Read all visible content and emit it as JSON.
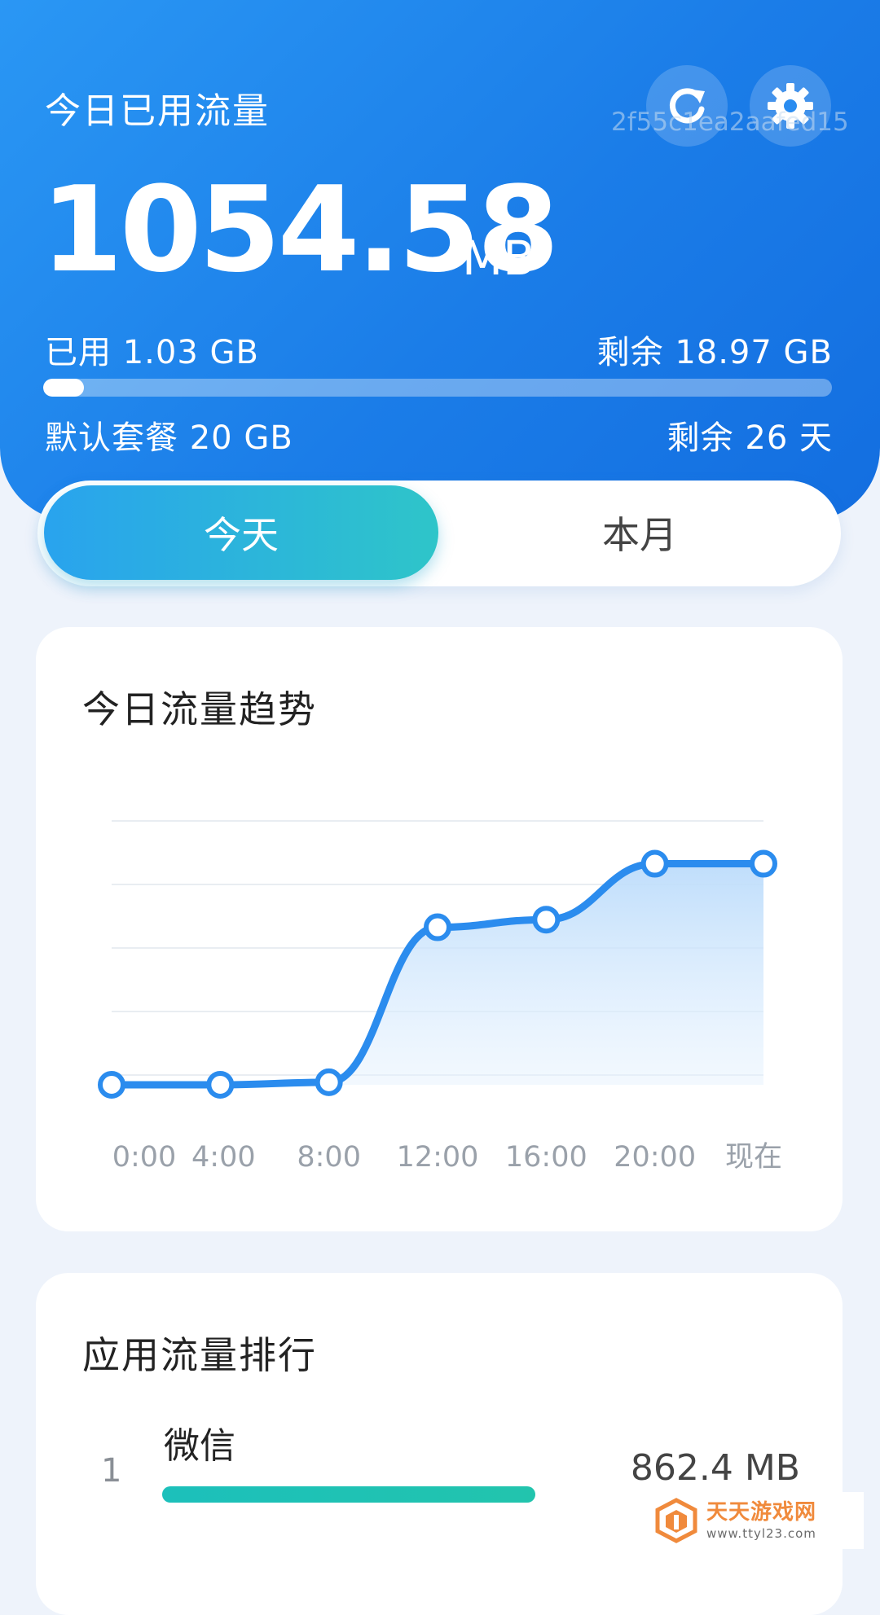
{
  "header": {
    "title": "今日已用流量",
    "device_id": "2f55c1ea2aafed15",
    "value": "1054.58",
    "unit": "MB",
    "used_label": "已用 1.03 GB",
    "remaining_label": "剩余 18.97 GB",
    "plan_label": "默认套餐 20 GB",
    "days_left_label": "剩余 26 天",
    "progress_fraction": 0.052
  },
  "toggle": {
    "today_label": "今天",
    "month_label": "本月",
    "selected": "today"
  },
  "trend": {
    "title": "今日流量趋势"
  },
  "chart_data": {
    "type": "area",
    "x_labels": [
      "0:00",
      "4:00",
      "8:00",
      "12:00",
      "16:00",
      "20:00",
      "现在"
    ],
    "points": [
      {
        "x": 0,
        "y": 0
      },
      {
        "x": 4,
        "y": 0
      },
      {
        "x": 8,
        "y": 0.01
      },
      {
        "x": 12,
        "y": 0.62
      },
      {
        "x": 16,
        "y": 0.65
      },
      {
        "x": 20,
        "y": 0.87
      },
      {
        "x": 24,
        "y": 0.87
      }
    ],
    "x_range": [
      0,
      24
    ],
    "y_range": [
      0,
      1
    ],
    "grid": true,
    "line_color": "#2b8cee"
  },
  "ranking": {
    "title": "应用流量排行",
    "items": [
      {
        "rank": "1",
        "name": "微信",
        "value": "862.4 MB",
        "fraction": 0.818
      }
    ]
  },
  "watermark": {
    "name": "天天游戏网",
    "url": "www.ttyl23.com"
  },
  "colors": {
    "header_blue": "#1b7de8",
    "accent_teal": "#1cc0bb",
    "chart_line": "#2b8cee"
  },
  "icons": {
    "refresh": "refresh-icon",
    "settings": "gear-icon"
  }
}
